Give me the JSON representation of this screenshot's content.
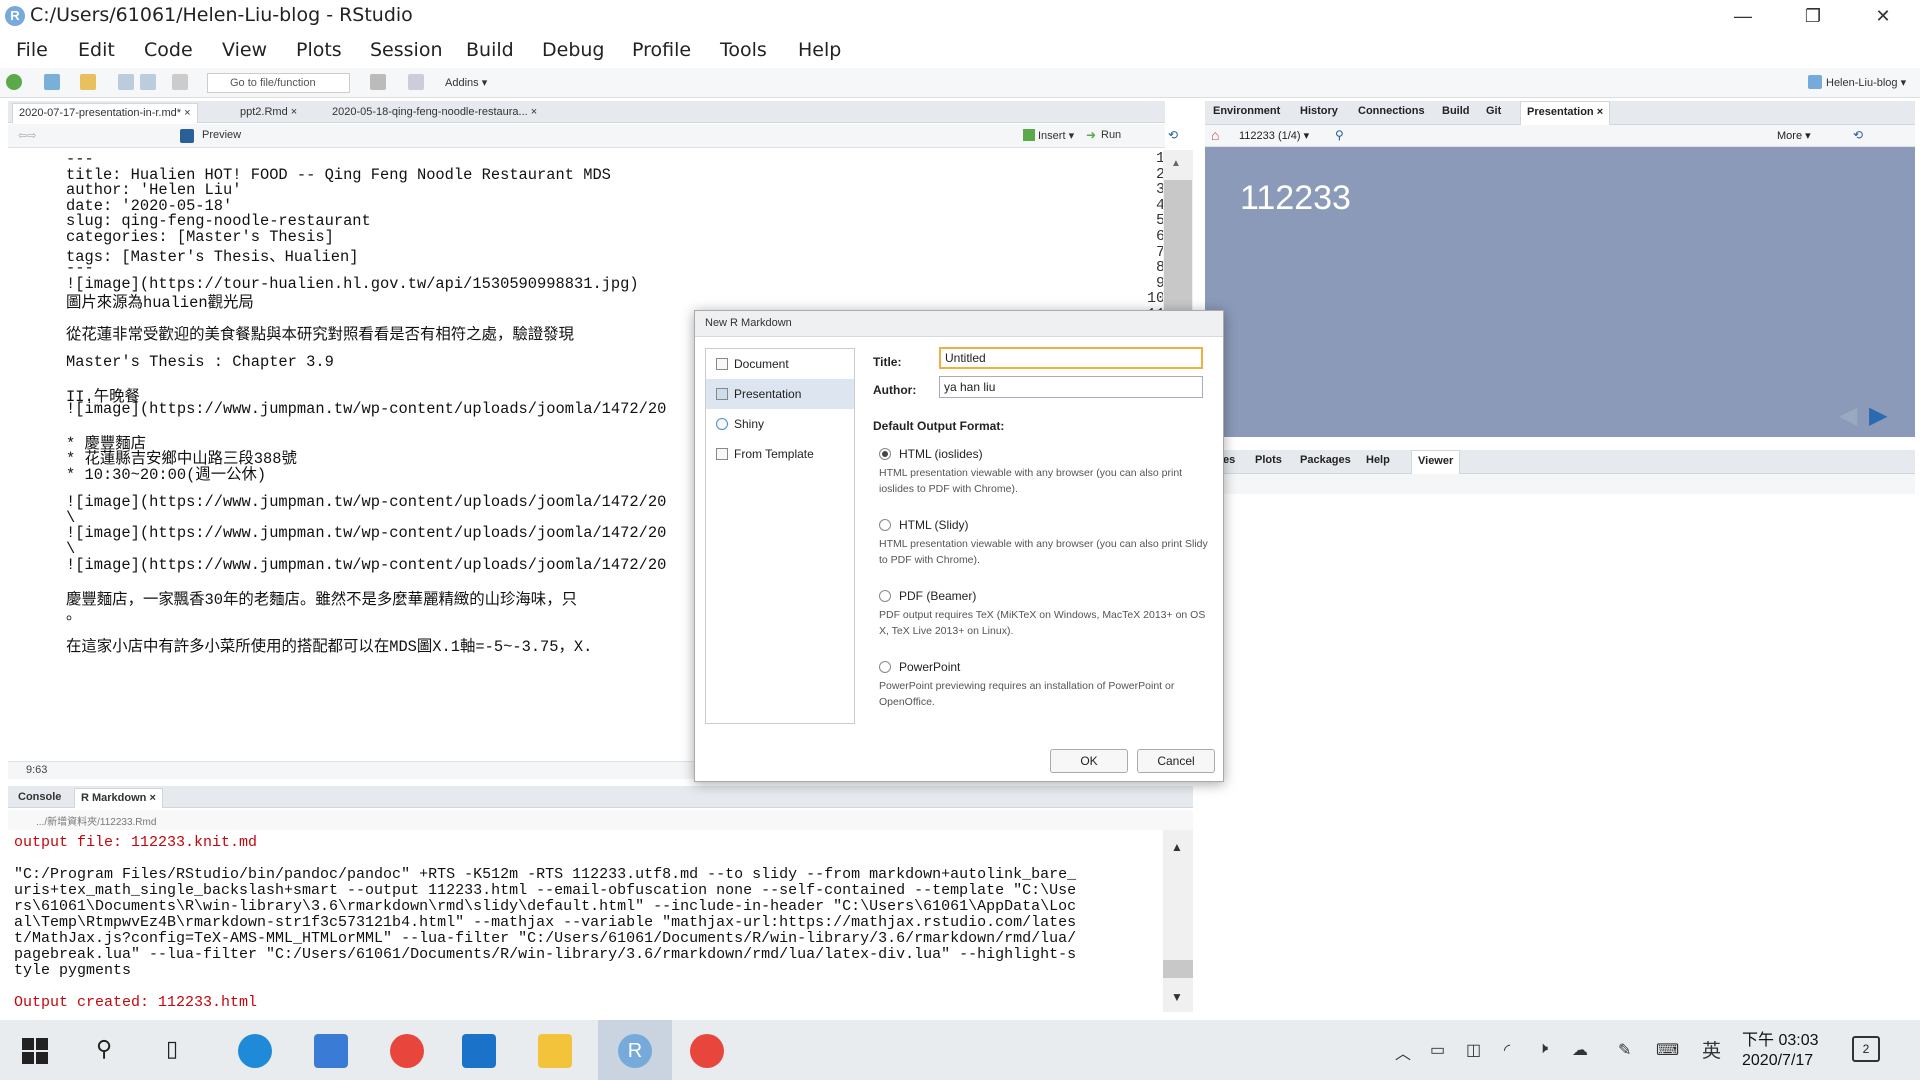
{
  "window": {
    "title": "C:/Users/61061/Helen-Liu-blog - RStudio",
    "controls": [
      "—",
      "❐",
      "✕"
    ]
  },
  "menu": [
    "File",
    "Edit",
    "Code",
    "View",
    "Plots",
    "Session",
    "Build",
    "Debug",
    "Profile",
    "Tools",
    "Help"
  ],
  "toolbar": {
    "goto_placeholder": "Go to file/function",
    "addins_label": "Addins ▾",
    "project_label": "Helen-Liu-blog ▾"
  },
  "editor": {
    "tabs": [
      "2020-07-17-presentation-in-r.md*",
      "ppt2.Rmd",
      "2020-05-18-qing-feng-noodle-restaura..."
    ],
    "preview_label": "Preview",
    "insert_label": "Insert ▾",
    "run_label": "Run",
    "cursor_position": "9:63",
    "lines": [
      {
        "n": "1",
        "text": "---"
      },
      {
        "n": "2",
        "text": "title: Hualien HOT! FOOD -- Qing Feng Noodle Restaurant MDS"
      },
      {
        "n": "3",
        "text": "author: 'Helen Liu'"
      },
      {
        "n": "4",
        "text": "date: '2020-05-18'"
      },
      {
        "n": "5",
        "text": "slug: qing-feng-noodle-restaurant"
      },
      {
        "n": "6",
        "text": "categories: [Master's Thesis]"
      },
      {
        "n": "7",
        "text": "tags: [Master's Thesis、Hualien]"
      },
      {
        "n": "8",
        "text": "---"
      },
      {
        "n": "9",
        "text": "![image](https://tour-hualien.hl.gov.tw/api/1530590998831.jpg)"
      },
      {
        "n": "10",
        "text": "圖片來源為hualien觀光局"
      },
      {
        "n": "11",
        "text": ""
      },
      {
        "n": "12",
        "text": "從花蓮非常受歡迎的美食餐點與本研究對照看看是否有相符之處，驗證發現"
      },
      {
        "n": "13",
        "text": ""
      },
      {
        "n": "14",
        "text": "Master's Thesis : Chapter 3.9"
      },
      {
        "n": "15",
        "text": ""
      },
      {
        "n": "16",
        "text": "II.午晚餐"
      },
      {
        "n": "17",
        "text": "![image](https://www.jumpman.tw/wp-content/uploads/joomla/1472/20"
      },
      {
        "n": "18",
        "text": ""
      },
      {
        "n": "19",
        "text": "* 慶豐麵店"
      },
      {
        "n": "20",
        "text": "* 花蓮縣吉安鄉中山路三段388號"
      },
      {
        "n": "21",
        "text": "* 10:30~20:00(週一公休)"
      },
      {
        "n": "22",
        "text": ""
      },
      {
        "n": "23",
        "text": "![image](https://www.jumpman.tw/wp-content/uploads/joomla/1472/20"
      },
      {
        "n": "24",
        "text": "\\"
      },
      {
        "n": "25",
        "text": "![image](https://www.jumpman.tw/wp-content/uploads/joomla/1472/20"
      },
      {
        "n": "26",
        "text": "\\"
      },
      {
        "n": "27",
        "text": "![image](https://www.jumpman.tw/wp-content/uploads/joomla/1472/20"
      },
      {
        "n": "28",
        "text": ""
      },
      {
        "n": "29",
        "text": "慶豐麵店，一家飄香30年的老麵店。雖然不是多麼華麗精緻的山珍海味，只"
      },
      {
        "n": "",
        "text": "。"
      },
      {
        "n": "30",
        "text": ""
      },
      {
        "n": "31",
        "text": "在這家小店中有許多小菜所使用的搭配都可以在MDS圖X.1軸=-5~-3.75，X."
      }
    ]
  },
  "console": {
    "tabs": [
      "Console",
      "R Markdown"
    ],
    "path": ".../新增資料夾/112233.Rmd",
    "lines": [
      {
        "text": "output file: 112233.knit.md",
        "red": true
      },
      {
        "text": "",
        "red": false
      },
      {
        "text": "\"C:/Program Files/RStudio/bin/pandoc/pandoc\" +RTS -K512m -RTS 112233.utf8.md --to slidy --from markdown+autolink_bare_",
        "red": false
      },
      {
        "text": "uris+tex_math_single_backslash+smart --output 112233.html --email-obfuscation none --self-contained --template \"C:\\Use",
        "red": false
      },
      {
        "text": "rs\\61061\\Documents\\R\\win-library\\3.6\\rmarkdown\\rmd\\slidy\\default.html\" --include-in-header \"C:\\Users\\61061\\AppData\\Loc",
        "red": false
      },
      {
        "text": "al\\Temp\\RtmpwvEz4B\\rmarkdown-str1f3c573121b4.html\" --mathjax --variable \"mathjax-url:https://mathjax.rstudio.com/lates",
        "red": false
      },
      {
        "text": "t/MathJax.js?config=TeX-AMS-MML_HTMLorMML\" --lua-filter \"C:/Users/61061/Documents/R/win-library/3.6/rmarkdown/rmd/lua/",
        "red": false
      },
      {
        "text": "pagebreak.lua\" --lua-filter \"C:/Users/61061/Documents/R/win-library/3.6/rmarkdown/rmd/lua/latex-div.lua\" --highlight-s",
        "red": false
      },
      {
        "text": "tyle pygments",
        "red": false
      },
      {
        "text": "",
        "red": false
      },
      {
        "text": "Output created: 112233.html",
        "red": true
      }
    ]
  },
  "env_pane": {
    "tabs": [
      "Environment",
      "History",
      "Connections",
      "Build",
      "Git",
      "Presentation"
    ],
    "active_tab": "Presentation",
    "slide_selector": "112233 (1/4) ▾",
    "more_label": "More ▾",
    "slide_title": "112233"
  },
  "files_pane": {
    "tabs": [
      "es",
      "Plots",
      "Packages",
      "Help",
      "Viewer"
    ]
  },
  "dialog": {
    "title": "New R Markdown",
    "categories": [
      "Document",
      "Presentation",
      "Shiny",
      "From Template"
    ],
    "selected_category": "Presentation",
    "title_label": "Title:",
    "title_value": "Untitled",
    "author_label": "Author:",
    "author_value": "ya han liu",
    "format_heading": "Default Output Format:",
    "formats": [
      {
        "name": "HTML (ioslides)",
        "desc": "HTML presentation viewable with any browser (you can also print ioslides to PDF with Chrome).",
        "selected": true
      },
      {
        "name": "HTML (Slidy)",
        "desc": "HTML presentation viewable with any browser (you can also print Slidy to PDF with Chrome).",
        "selected": false
      },
      {
        "name": "PDF (Beamer)",
        "desc": "PDF output requires TeX (MiKTeX on Windows, MacTeX 2013+ on OS X, TeX Live 2013+ on Linux).",
        "selected": false
      },
      {
        "name": "PowerPoint",
        "desc": "PowerPoint previewing requires an installation of PowerPoint or OpenOffice.",
        "selected": false
      }
    ],
    "ok_label": "OK",
    "cancel_label": "Cancel"
  },
  "taskbar": {
    "time": "下午 03:03",
    "date": "2020/7/17",
    "ime": "英",
    "notifications": "2"
  }
}
